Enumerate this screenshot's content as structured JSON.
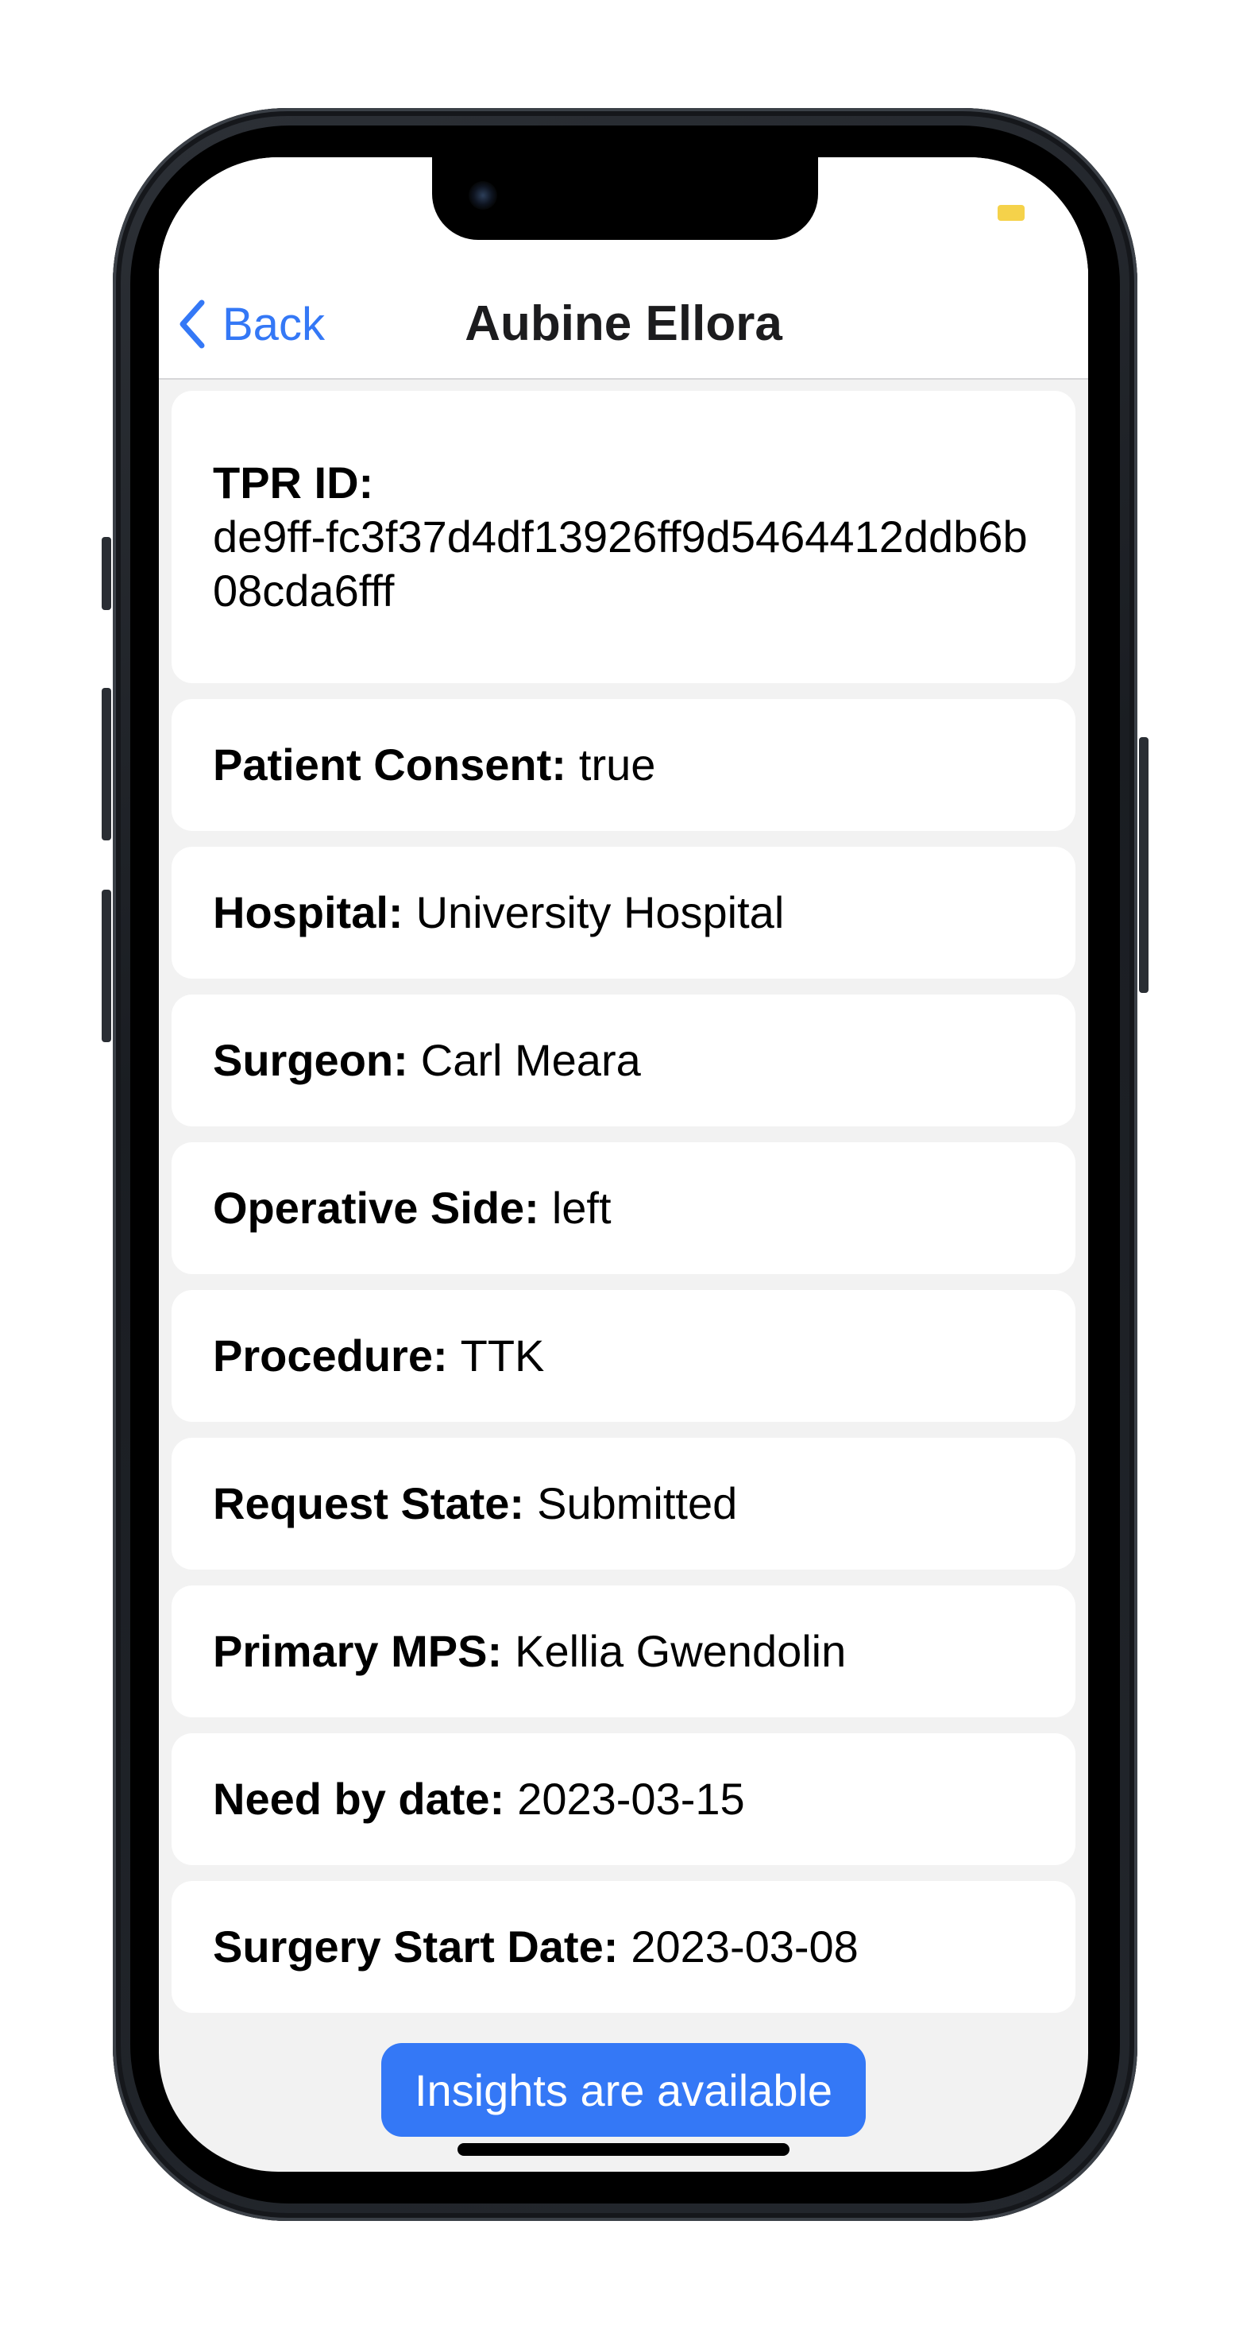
{
  "nav": {
    "back_label": "Back",
    "title": "Aubine Ellora"
  },
  "details": {
    "tpr_id_label": "TPR ID:",
    "tpr_id_value": "de9ff-fc3f37d4df13926ff9d5464412ddb6b08cda6fff",
    "patient_consent_label": "Patient Consent:",
    "patient_consent_value": "true",
    "hospital_label": "Hospital:",
    "hospital_value": "University Hospital",
    "surgeon_label": "Surgeon:",
    "surgeon_value": "Carl Meara",
    "operative_side_label": "Operative Side:",
    "operative_side_value": "left",
    "procedure_label": "Procedure:",
    "procedure_value": "TTK",
    "request_state_label": "Request State:",
    "request_state_value": "Submitted",
    "primary_mps_label": "Primary MPS:",
    "primary_mps_value": "Kellia Gwendolin",
    "need_by_date_label": "Need by date:",
    "need_by_date_value": "2023-03-15",
    "surgery_start_date_label": "Surgery Start Date:",
    "surgery_start_date_value": "2023-03-08"
  },
  "footer": {
    "insights_button": "Insights are available"
  },
  "icons": {
    "back": "chevron-left-icon",
    "battery": "battery-icon"
  },
  "colors": {
    "accent": "#3478f6",
    "background": "#f2f2f2",
    "card": "#ffffff",
    "battery": "#f5d24a"
  }
}
